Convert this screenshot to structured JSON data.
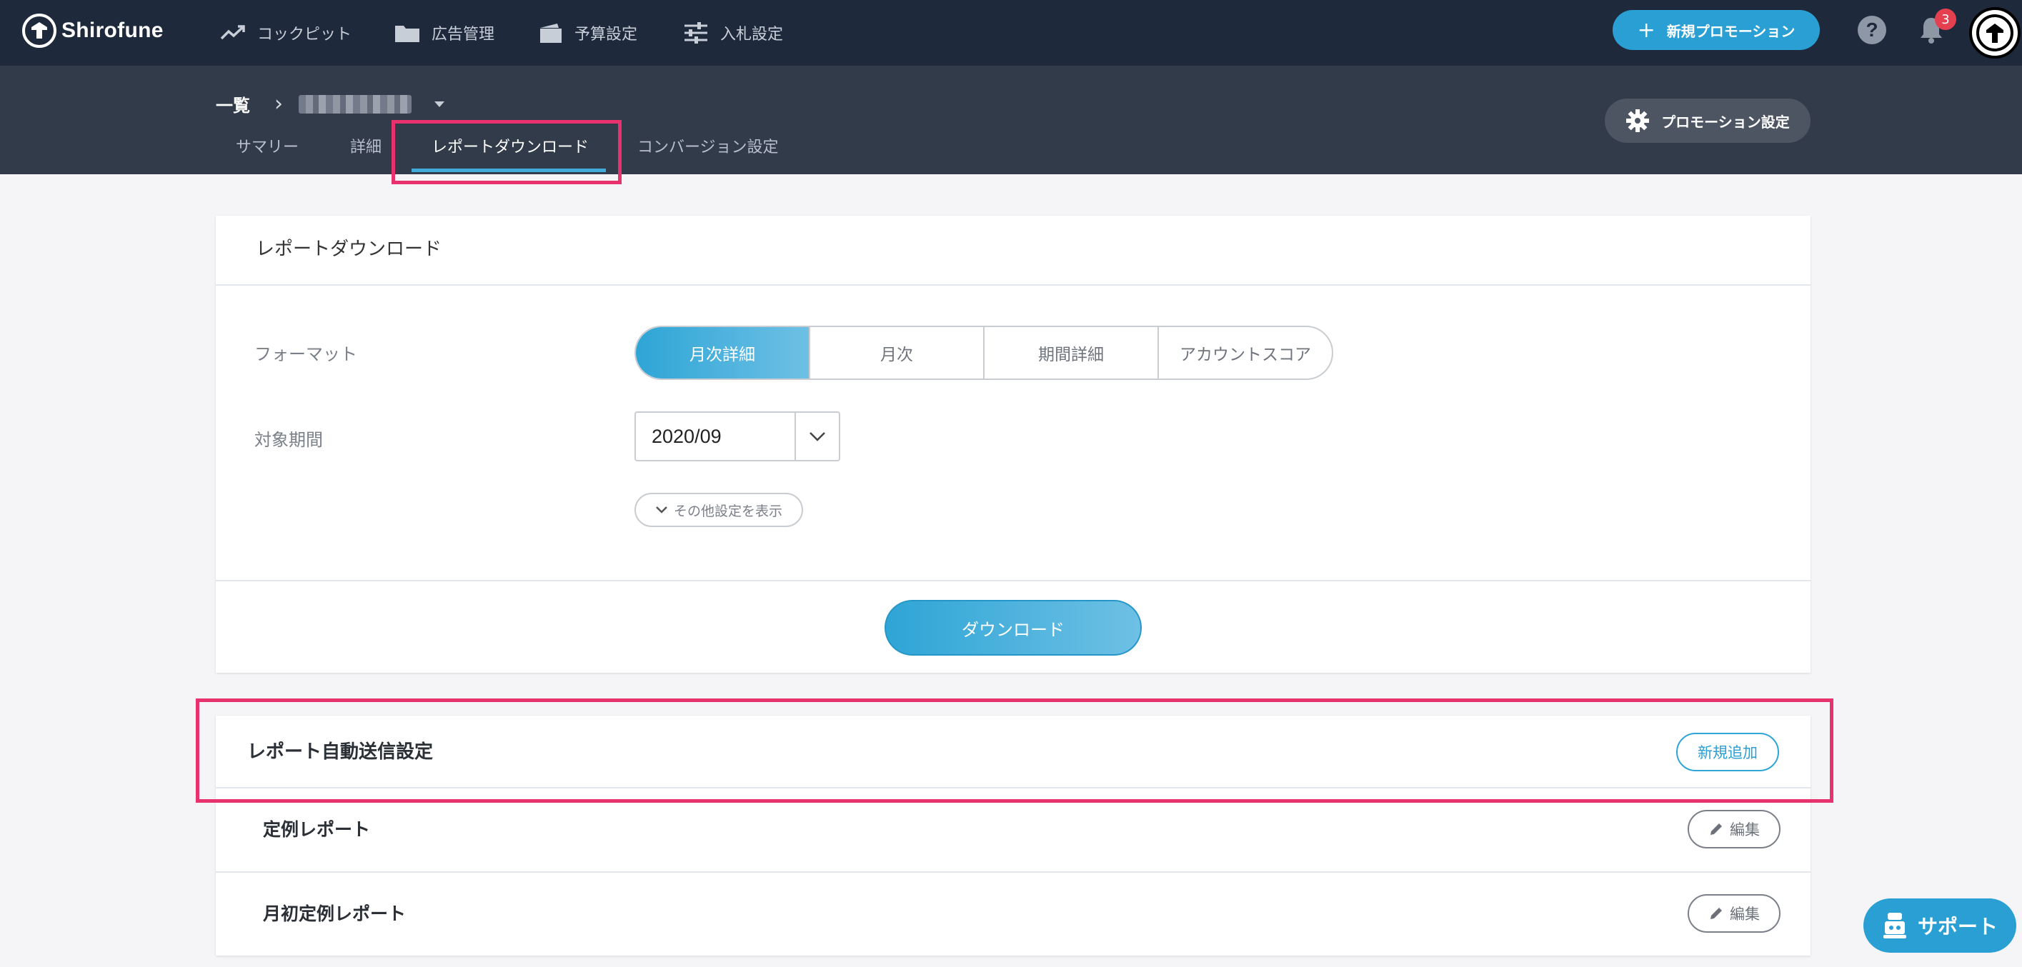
{
  "app": {
    "brand": "Shirofune"
  },
  "topnav": {
    "items": [
      {
        "label": "コックピット",
        "icon": "trend-icon"
      },
      {
        "label": "広告管理",
        "icon": "folder-icon"
      },
      {
        "label": "予算設定",
        "icon": "wallet-icon"
      },
      {
        "label": "入札設定",
        "icon": "sliders-icon"
      }
    ],
    "new_promotion_label": "新規プロモーション",
    "help_label": "?",
    "notification_count": "3"
  },
  "breadcrumb": {
    "root": "一覧",
    "separator": "›"
  },
  "tabs": [
    {
      "label": "サマリー"
    },
    {
      "label": "詳細"
    },
    {
      "label": "レポートダウンロード",
      "active": true
    },
    {
      "label": "コンバージョン設定"
    }
  ],
  "promotion_settings_label": "プロモーション設定",
  "report_download": {
    "title": "レポートダウンロード",
    "format_label": "フォーマット",
    "format_options": [
      "月次詳細",
      "月次",
      "期間詳細",
      "アカウントスコア"
    ],
    "format_selected": "月次詳細",
    "period_label": "対象期間",
    "period_value": "2020/09",
    "more_settings_label": "その他設定を表示",
    "download_label": "ダウンロード"
  },
  "auto_send": {
    "title": "レポート自動送信設定",
    "add_label": "新規追加",
    "reports": [
      {
        "name": "定例レポート",
        "edit_label": "編集"
      },
      {
        "name": "月初定例レポート",
        "edit_label": "編集"
      }
    ]
  },
  "support_label": "サポート",
  "colors": {
    "nav_bg": "#1e2a3c",
    "subheader_bg": "#323b4a",
    "accent": "#2a9fd4",
    "highlight": "#e8326e",
    "badge": "#e5404f"
  }
}
